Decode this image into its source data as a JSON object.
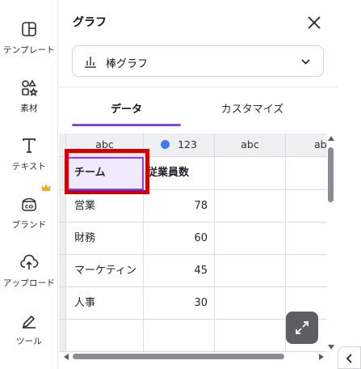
{
  "sidebar": {
    "items": [
      {
        "label": "テンプレート",
        "icon": "template-icon"
      },
      {
        "label": "素材",
        "icon": "elements-icon"
      },
      {
        "label": "テキスト",
        "icon": "text-icon"
      },
      {
        "label": "ブランド",
        "icon": "brand-icon",
        "badge": "crown-icon"
      },
      {
        "label": "アップロード",
        "icon": "upload-icon"
      },
      {
        "label": "ツール",
        "icon": "tools-icon"
      }
    ]
  },
  "panel": {
    "title": "グラフ",
    "chart_type": {
      "label": "棒グラフ",
      "icon": "bar-chart-icon"
    },
    "tabs": [
      {
        "label": "データ",
        "active": true
      },
      {
        "label": "カスタマイズ",
        "active": false
      }
    ]
  },
  "grid": {
    "column_headers": [
      "abc",
      "123",
      "abc",
      "ab"
    ],
    "series_color": "#3b7bef",
    "header_row": [
      "チーム",
      "従業員数"
    ],
    "rows": [
      {
        "label": "営業",
        "value": "78"
      },
      {
        "label": "財務",
        "value": "60"
      },
      {
        "label": "マーケティン",
        "value": "45"
      },
      {
        "label": "人事",
        "value": "30"
      }
    ]
  },
  "colors": {
    "accent": "#8b3dff",
    "highlight": "#cc0000"
  }
}
